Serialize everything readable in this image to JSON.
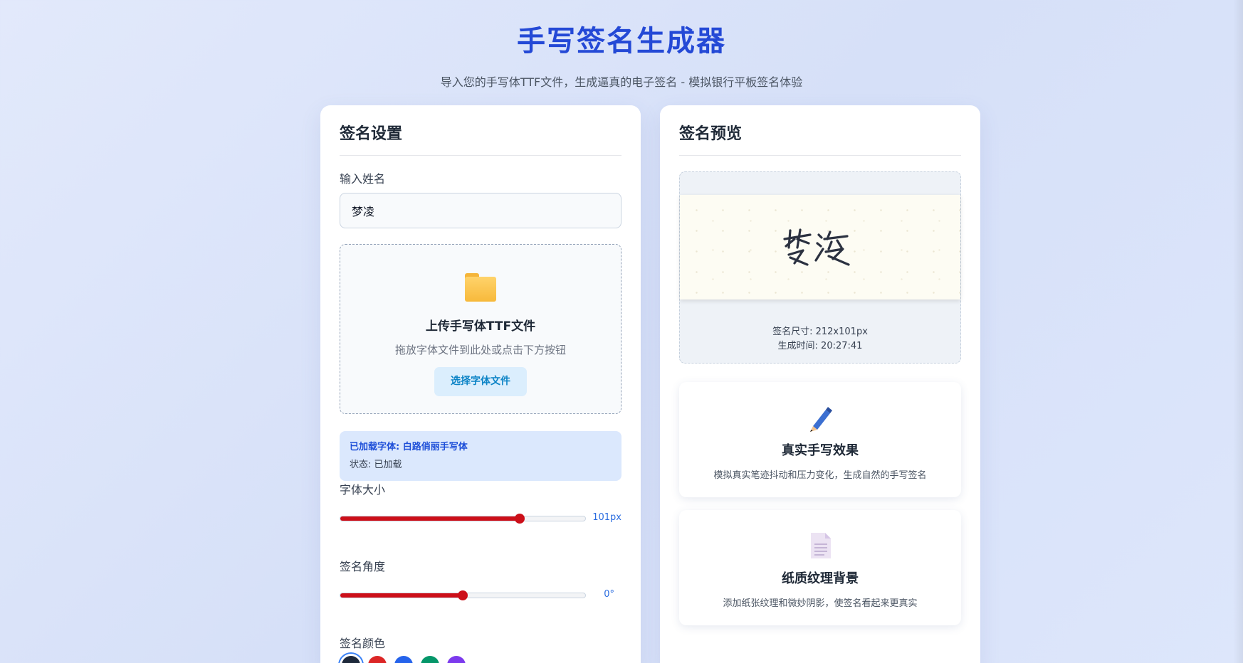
{
  "header": {
    "title": "手写签名生成器",
    "subtitle": "导入您的手写体TTF文件，生成逼真的电子签名 - 模拟银行平板签名体验"
  },
  "settings": {
    "title": "签名设置",
    "name_label": "输入姓名",
    "name_value": "梦凌",
    "upload": {
      "icon": "folder-icon",
      "title": "上传手写体TTF文件",
      "hint": "拖放字体文件到此处或点击下方按钮",
      "button_label": "选择字体文件"
    },
    "font_info": {
      "loaded": "已加载字体: 白路俏丽手写体",
      "status": "状态: 已加载"
    },
    "font_size": {
      "label": "字体大小",
      "value_text": "101px",
      "fraction": 0.73
    },
    "angle": {
      "label": "签名角度",
      "value_text": "0°",
      "fraction": 0.5
    },
    "color": {
      "label": "签名颜色",
      "swatches": [
        "#1e293b",
        "#dc2626",
        "#2563eb",
        "#059669",
        "#7c3aed"
      ],
      "selected": 0
    }
  },
  "preview": {
    "title": "签名预览",
    "size_text": "签名尺寸: 212x101px",
    "time_text": "生成时间: 20:27:41"
  },
  "features": [
    {
      "icon": "pen-icon",
      "title": "真实手写效果",
      "desc": "模拟真实笔迹抖动和压力变化，生成自然的手写签名"
    },
    {
      "icon": "document-icon",
      "title": "纸质纹理背景",
      "desc": "添加纸张纹理和微妙阴影，使签名看起来更真实"
    }
  ]
}
